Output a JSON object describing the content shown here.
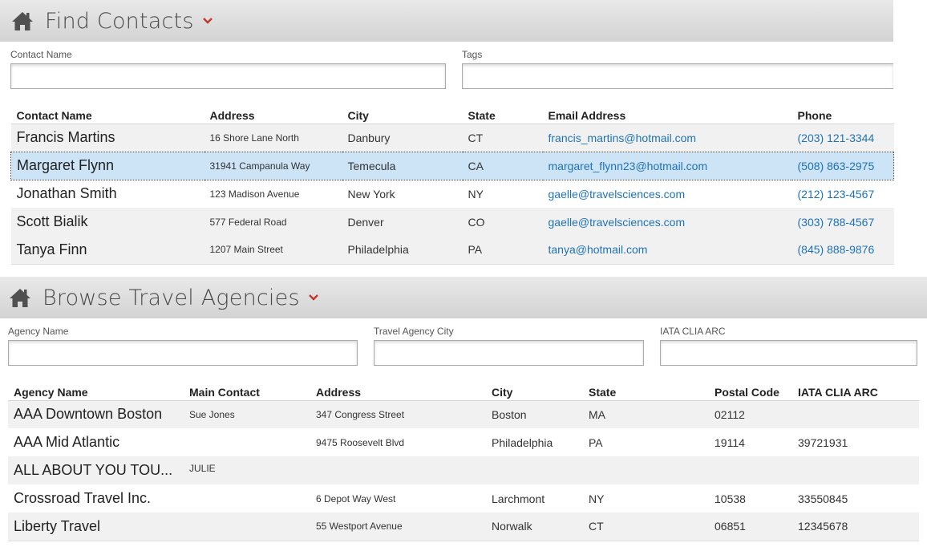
{
  "contacts": {
    "title": "Find Contacts",
    "filters": {
      "contact_name_label": "Contact Name",
      "contact_name_value": "",
      "tags_label": "Tags",
      "tags_value": ""
    },
    "columns": [
      "Contact Name",
      "Address",
      "City",
      "State",
      "Email Address",
      "Phone"
    ],
    "rows": [
      {
        "name": "Francis Martins",
        "address": "16 Shore Lane North",
        "city": "Danbury",
        "state": "CT",
        "email": "francis_martins@hotmail.com",
        "phone": "(203) 121-3344"
      },
      {
        "name": "Margaret Flynn",
        "address": "31941 Campanula Way",
        "city": "Temecula",
        "state": "CA",
        "email": "margaret_flynn23@hotmail.com",
        "phone": "(508) 863-2975"
      },
      {
        "name": "Jonathan Smith",
        "address": "123 Madison Avenue",
        "city": "New York",
        "state": "NY",
        "email": "gaelle@travelsciences.com",
        "phone": "(212) 123-4567"
      },
      {
        "name": "Scott Bialik",
        "address": "577 Federal Road",
        "city": "Denver",
        "state": "CO",
        "email": "gaelle@travelsciences.com",
        "phone": "(303) 788-4567"
      },
      {
        "name": "Tanya Finn",
        "address": "1207 Main Street",
        "city": "Philadelphia",
        "state": "PA",
        "email": "tanya@hotmail.com",
        "phone": "(845) 888-9876"
      }
    ],
    "selected_row": 1
  },
  "agencies": {
    "title": "Browse Travel Agencies",
    "filters": {
      "agency_name_label": "Agency Name",
      "agency_name_value": "",
      "city_label": "Travel Agency City",
      "city_value": "",
      "iata_label": "IATA CLIA ARC",
      "iata_value": ""
    },
    "columns": [
      "Agency Name",
      "Main Contact",
      "Address",
      "City",
      "State",
      "Postal Code",
      "IATA CLIA ARC"
    ],
    "rows": [
      {
        "name": "AAA Downtown Boston",
        "contact": "Sue Jones",
        "address": "347 Congress Street",
        "city": "Boston",
        "state": "MA",
        "postal": "02112",
        "iata": ""
      },
      {
        "name": "AAA Mid Atlantic",
        "contact": "",
        "address": "9475 Roosevelt Blvd",
        "city": "Philadelphia",
        "state": "PA",
        "postal": "19114",
        "iata": "39721931"
      },
      {
        "name": "ALL ABOUT YOU TOU...",
        "contact": "JULIE",
        "address": "",
        "city": "",
        "state": "",
        "postal": "",
        "iata": ""
      },
      {
        "name": "Crossroad Travel Inc.",
        "contact": "",
        "address": "6 Depot Way West",
        "city": "Larchmont",
        "state": "NY",
        "postal": "10538",
        "iata": "33550845"
      },
      {
        "name": "Liberty Travel",
        "contact": "",
        "address": "55 Westport Avenue",
        "city": "Norwalk",
        "state": "CT",
        "postal": "06851",
        "iata": "12345678"
      }
    ]
  },
  "icons": {
    "home": "home-icon",
    "dropdown": "chevron-down-icon"
  },
  "colors": {
    "accent_chevron": "#c0392b",
    "link": "#1e73b8",
    "selected_row": "#cde3f6",
    "header_bg": "#d9d9d9"
  }
}
